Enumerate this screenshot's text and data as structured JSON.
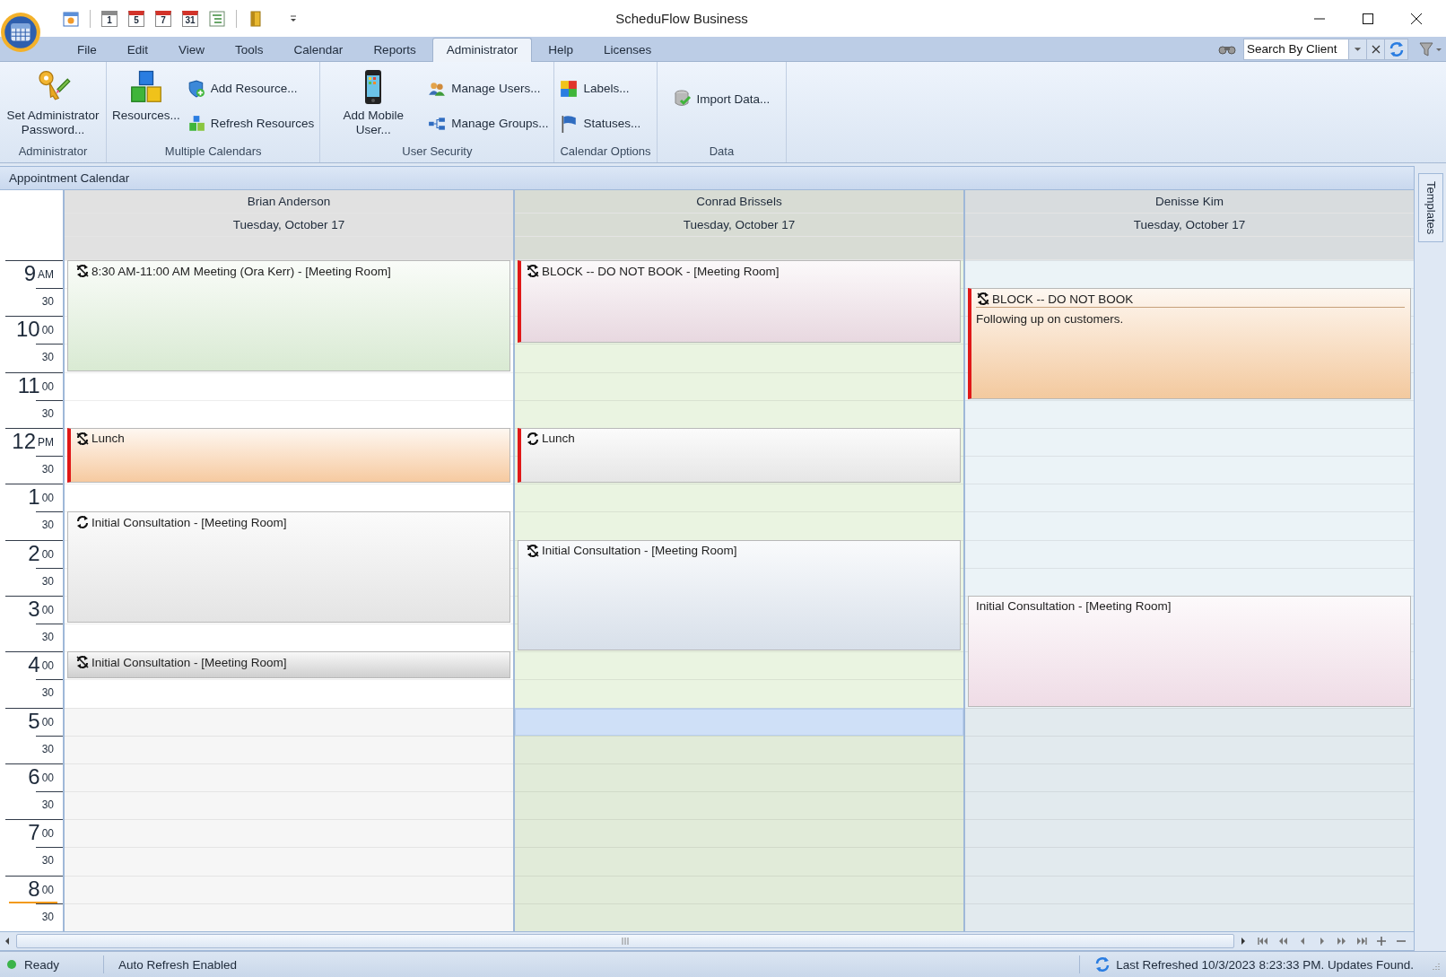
{
  "window": {
    "title": "ScheduFlow Business"
  },
  "quick_access_days": [
    "1",
    "5",
    "7",
    "31"
  ],
  "menu_tabs": [
    {
      "label": "File",
      "selected": false
    },
    {
      "label": "Edit",
      "selected": false
    },
    {
      "label": "View",
      "selected": false
    },
    {
      "label": "Tools",
      "selected": false
    },
    {
      "label": "Calendar",
      "selected": false
    },
    {
      "label": "Reports",
      "selected": false
    },
    {
      "label": "Administrator",
      "selected": true
    },
    {
      "label": "Help",
      "selected": false
    },
    {
      "label": "Licenses",
      "selected": false
    }
  ],
  "search": {
    "value": "Search By Client"
  },
  "ribbon_groups": [
    {
      "title": "Administrator",
      "items": [
        {
          "kind": "large",
          "label": "Set Administrator Password..."
        }
      ]
    },
    {
      "title": "Multiple Calendars",
      "items": [
        {
          "kind": "large",
          "label": "Resources..."
        },
        {
          "kind": "small",
          "label": "Add Resource..."
        },
        {
          "kind": "small",
          "label": "Refresh Resources"
        }
      ]
    },
    {
      "title": "User Security",
      "items": [
        {
          "kind": "large",
          "label": "Add Mobile User..."
        },
        {
          "kind": "small",
          "label": "Manage Users..."
        },
        {
          "kind": "small",
          "label": "Manage Groups..."
        }
      ]
    },
    {
      "title": "Calendar Options",
      "items": [
        {
          "kind": "small",
          "label": "Labels..."
        },
        {
          "kind": "small",
          "label": "Statuses..."
        }
      ]
    },
    {
      "title": "Data",
      "items": [
        {
          "kind": "single",
          "label": "Import Data..."
        }
      ]
    }
  ],
  "calendar": {
    "title": "Appointment Calendar",
    "time_slots": [
      {
        "hour": "9",
        "mark": "AM",
        "current": false
      },
      {
        "mark": "30",
        "current": false
      },
      {
        "hour": "10",
        "mark": "00",
        "current": false
      },
      {
        "mark": "30",
        "current": false
      },
      {
        "hour": "11",
        "mark": "00",
        "current": false
      },
      {
        "mark": "30",
        "current": false
      },
      {
        "hour": "12",
        "mark": "PM",
        "current": false
      },
      {
        "mark": "30",
        "current": false
      },
      {
        "hour": "1",
        "mark": "00",
        "current": false
      },
      {
        "mark": "30",
        "current": false
      },
      {
        "hour": "2",
        "mark": "00",
        "current": false
      },
      {
        "mark": "30",
        "current": false
      },
      {
        "hour": "3",
        "mark": "00",
        "current": false
      },
      {
        "mark": "30",
        "current": false
      },
      {
        "hour": "4",
        "mark": "00",
        "current": false
      },
      {
        "mark": "30",
        "current": false
      },
      {
        "hour": "5",
        "mark": "00",
        "current": false
      },
      {
        "mark": "30",
        "current": false
      },
      {
        "hour": "6",
        "mark": "00",
        "current": false
      },
      {
        "mark": "30",
        "current": false
      },
      {
        "hour": "7",
        "mark": "00",
        "current": false
      },
      {
        "mark": "30",
        "current": false
      },
      {
        "hour": "8",
        "mark": "00",
        "current": true
      },
      {
        "mark": "30",
        "current": false
      }
    ],
    "resources": [
      {
        "name": "Brian Anderson",
        "date": "Tuesday, October 17",
        "color": "#ffffff",
        "timeline": [
          {
            "kind": "event",
            "selected": false,
            "title": "8:30 AM-11:00 AM Meeting (Ora Kerr) - [Meeting Room]",
            "color": "#d9ead3",
            "busy": false,
            "recurring": true,
            "exception": true
          },
          {
            "kind": "more",
            "selected": false
          },
          {
            "kind": "more",
            "selected": false
          },
          {
            "kind": "more",
            "selected": false
          },
          {
            "kind": "free",
            "selected": false
          },
          {
            "kind": "free",
            "selected": false
          },
          {
            "kind": "event",
            "selected": false,
            "title": "Lunch",
            "color": "#f6caa0",
            "busy": true,
            "recurring": true,
            "exception": true
          },
          {
            "kind": "more",
            "selected": false
          },
          {
            "kind": "free",
            "selected": false
          },
          {
            "kind": "event",
            "selected": false,
            "title": "Initial Consultation - [Meeting Room]",
            "color": "#e4e4e4",
            "busy": false,
            "recurring": true,
            "exception": false
          },
          {
            "kind": "more",
            "selected": false
          },
          {
            "kind": "more",
            "selected": false
          },
          {
            "kind": "more",
            "selected": false
          },
          {
            "kind": "free",
            "selected": false
          },
          {
            "kind": "event",
            "selected": false,
            "title": "Initial Consultation - [Meeting Room]",
            "color": "#cfcfcf",
            "busy": false,
            "recurring": true,
            "exception": true
          },
          {
            "kind": "free",
            "selected": false
          },
          {
            "kind": "off",
            "selected": false
          },
          {
            "kind": "off",
            "selected": false
          },
          {
            "kind": "off",
            "selected": false
          },
          {
            "kind": "off",
            "selected": false
          },
          {
            "kind": "off",
            "selected": false
          },
          {
            "kind": "off",
            "selected": false
          },
          {
            "kind": "off",
            "selected": false
          },
          {
            "kind": "off",
            "selected": false
          }
        ]
      },
      {
        "name": "Conrad Brissels",
        "date": "Tuesday, October 17",
        "color": "#eaf4e1",
        "timeline": [
          {
            "kind": "event",
            "selected": false,
            "title": "BLOCK -- DO NOT BOOK - [Meeting Room]",
            "color": "#e8d8e0",
            "busy": true,
            "recurring": true,
            "exception": true
          },
          {
            "kind": "more",
            "selected": false
          },
          {
            "kind": "more",
            "selected": false
          },
          {
            "kind": "free",
            "selected": false
          },
          {
            "kind": "free",
            "selected": false
          },
          {
            "kind": "free",
            "selected": false
          },
          {
            "kind": "event",
            "selected": false,
            "title": "Lunch",
            "color": "#e6e6e6",
            "busy": true,
            "recurring": true,
            "exception": false
          },
          {
            "kind": "more",
            "selected": false
          },
          {
            "kind": "free",
            "selected": false
          },
          {
            "kind": "free",
            "selected": false
          },
          {
            "kind": "event",
            "selected": false,
            "title": "Initial Consultation - [Meeting Room]",
            "color": "#d8e0ea",
            "busy": false,
            "recurring": true,
            "exception": true
          },
          {
            "kind": "more",
            "selected": false
          },
          {
            "kind": "more",
            "selected": false
          },
          {
            "kind": "more",
            "selected": false
          },
          {
            "kind": "free",
            "selected": false
          },
          {
            "kind": "free",
            "selected": false
          },
          {
            "kind": "off",
            "selected": true
          },
          {
            "kind": "off",
            "selected": false
          },
          {
            "kind": "off",
            "selected": false
          },
          {
            "kind": "off",
            "selected": false
          },
          {
            "kind": "off",
            "selected": false
          },
          {
            "kind": "off",
            "selected": false
          },
          {
            "kind": "off",
            "selected": false
          },
          {
            "kind": "off",
            "selected": false
          }
        ]
      },
      {
        "name": "Denisse Kim",
        "date": "Tuesday, October 17",
        "color": "#ebf3f7",
        "timeline": [
          {
            "kind": "free",
            "selected": false
          },
          {
            "kind": "event",
            "selected": false,
            "title": "BLOCK -- DO NOT BOOK",
            "description": "Following up on customers.",
            "color": "#f3c99e",
            "busy": true,
            "recurring": true,
            "exception": true
          },
          {
            "kind": "more",
            "selected": false
          },
          {
            "kind": "more",
            "selected": false
          },
          {
            "kind": "more",
            "selected": false
          },
          {
            "kind": "free",
            "selected": false
          },
          {
            "kind": "free",
            "selected": false
          },
          {
            "kind": "free",
            "selected": false
          },
          {
            "kind": "free",
            "selected": false
          },
          {
            "kind": "free",
            "selected": false
          },
          {
            "kind": "free",
            "selected": false
          },
          {
            "kind": "free",
            "selected": false
          },
          {
            "kind": "event",
            "selected": false,
            "title": "Initial Consultation - [Meeting Room]",
            "color": "#efdce6",
            "busy": false,
            "recurring": false
          },
          {
            "kind": "more",
            "selected": false
          },
          {
            "kind": "more",
            "selected": false
          },
          {
            "kind": "more",
            "selected": false
          },
          {
            "kind": "off",
            "selected": false
          },
          {
            "kind": "off",
            "selected": false
          },
          {
            "kind": "off",
            "selected": false
          },
          {
            "kind": "off",
            "selected": false
          },
          {
            "kind": "off",
            "selected": false
          },
          {
            "kind": "off",
            "selected": false
          },
          {
            "kind": "off",
            "selected": false
          },
          {
            "kind": "off",
            "selected": false
          }
        ]
      }
    ]
  },
  "side_tab": {
    "label": "Templates"
  },
  "status_bar": {
    "ready": "Ready",
    "auto_refresh": "Auto Refresh Enabled",
    "last_refreshed": "Last Refreshed 10/3/2023 8:23:33 PM. Updates Found."
  }
}
